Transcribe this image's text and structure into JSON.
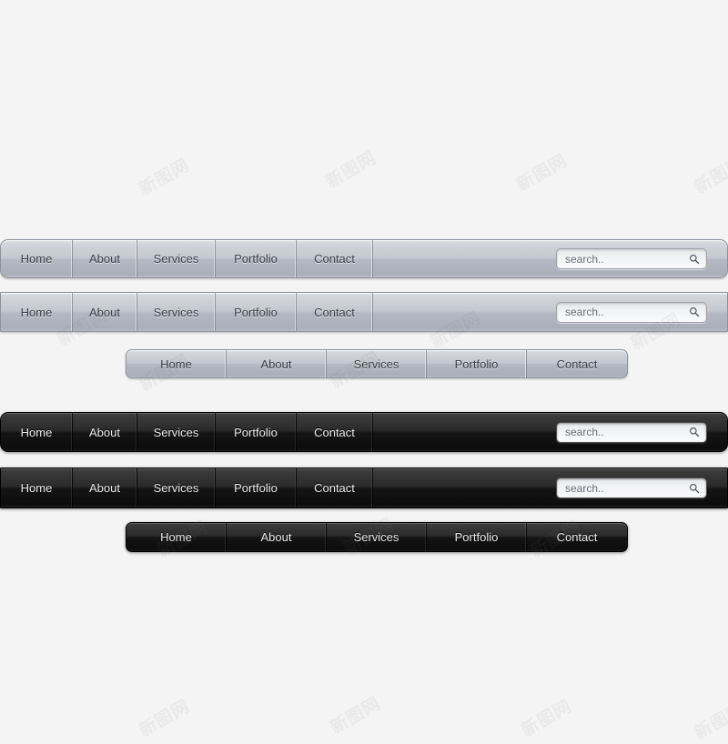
{
  "page": {
    "background_color": "#f4f4f4",
    "watermark_text": "新图网"
  },
  "nav_items": [
    {
      "label": "Home"
    },
    {
      "label": "About"
    },
    {
      "label": "Services"
    },
    {
      "label": "Portfolio"
    },
    {
      "label": "Contact"
    }
  ],
  "search": {
    "value": "",
    "placeholder": "search..",
    "icon": "search-icon"
  },
  "bars": [
    {
      "id": "bar1",
      "theme": "light",
      "corners": "rounded",
      "layout": "full",
      "has_search": true,
      "accent_top": "#e4e6ea",
      "accent_bottom": "#a9aeb9"
    },
    {
      "id": "bar2",
      "theme": "light",
      "corners": "square",
      "layout": "full",
      "has_search": true,
      "accent_top": "#e4e6ea",
      "accent_bottom": "#a9aeb9"
    },
    {
      "id": "bar3",
      "theme": "light",
      "corners": "rounded",
      "layout": "compact",
      "has_search": false,
      "accent_top": "#e4e6ea",
      "accent_bottom": "#a9aeb9"
    },
    {
      "id": "bar4",
      "theme": "dark",
      "corners": "rounded",
      "layout": "full",
      "has_search": true,
      "accent_top": "#454545",
      "accent_bottom": "#0c0c0c"
    },
    {
      "id": "bar5",
      "theme": "dark",
      "corners": "square",
      "layout": "full",
      "has_search": true,
      "accent_top": "#454545",
      "accent_bottom": "#0c0c0c"
    },
    {
      "id": "bar6",
      "theme": "dark",
      "corners": "rounded",
      "layout": "compact",
      "has_search": false,
      "accent_top": "#454545",
      "accent_bottom": "#0c0c0c"
    }
  ]
}
